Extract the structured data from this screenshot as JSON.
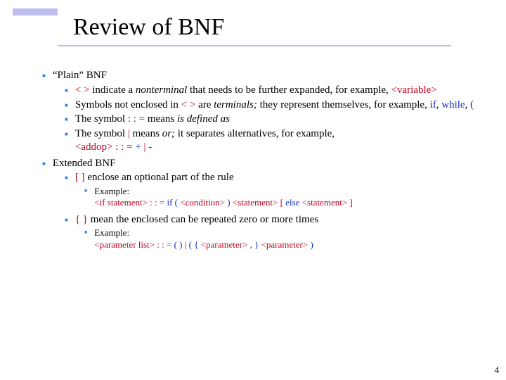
{
  "title": "Review of BNF",
  "pageNumber": "4",
  "l1": {
    "plain": "“Plain” BNF",
    "ext": "Extended BNF"
  },
  "plain": {
    "p1a": "< >",
    "p1b": " indicate a ",
    "p1c": "nonterminal",
    "p1d": " that needs to be further expanded, for example, ",
    "p1e": "<variable>",
    "p2a": "Symbols not enclosed in ",
    "p2b": "< >",
    "p2c": " are ",
    "p2d": "terminals;",
    "p2e": " they represent themselves, for example, ",
    "p2f": "if",
    "p2g": ", ",
    "p2h": "while",
    "p2i": ", ",
    "p2j": "(",
    "p3a": "The symbol ",
    "p3b": ": : =",
    "p3c": " means ",
    "p3d": "is defined as",
    "p4a": "The symbol  ",
    "p4b": "|",
    "p4c": "  means ",
    "p4d": "or;",
    "p4e": " it separates alternatives, for example, ",
    "p4f": "<addop>",
    "p4g": " : : = ",
    "p4h": "+",
    "p4i": " | ",
    "p4j": "-"
  },
  "ext": {
    "e1a": "[ ]",
    "e1b": "  enclose an optional part of the rule",
    "x1a": "Example:",
    "x1b": "<if statement>",
    "x1c": " : : = ",
    "x1d": "if (",
    "x1e": " <condition> ",
    "x1f": ")",
    "x1g": " <statement> ",
    "x1h": "[",
    "x1i": " else",
    "x1j": " <statement> ",
    "x1k": "]",
    "e2a": "{ }",
    "e2b": "  mean the enclosed can be repeated zero or more times",
    "x2a": "Example:",
    "x2b": "<parameter list>",
    "x2c": " : : = ",
    "x2d": "( )",
    "x2e": " |   ",
    "x2f": "( {",
    "x2g": " <parameter> ",
    "x2h": ", }",
    "x2i": " <parameter> ",
    "x2j": ")"
  }
}
